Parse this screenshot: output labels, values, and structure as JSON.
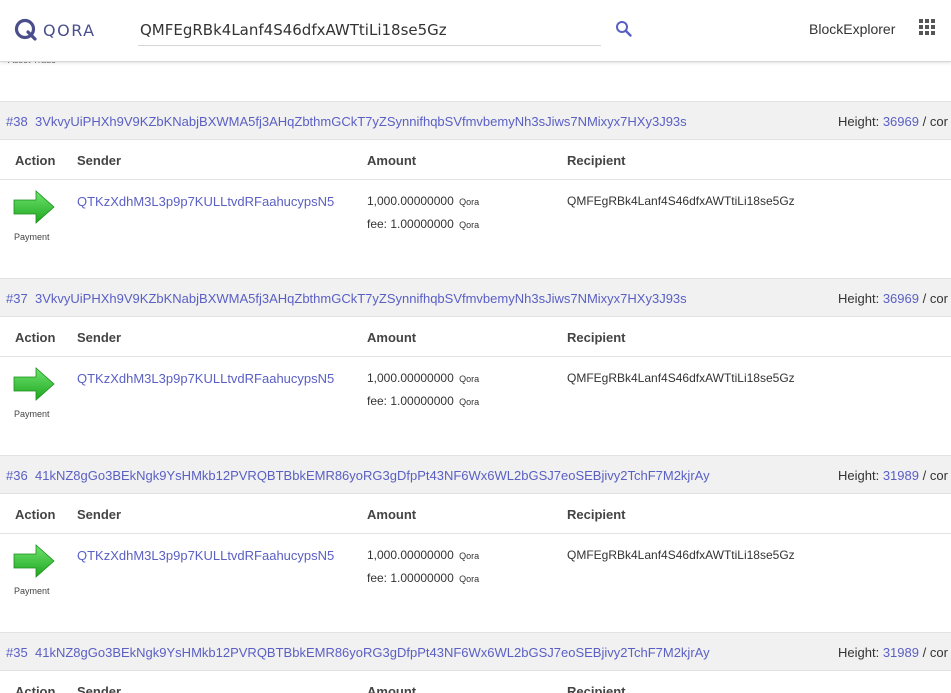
{
  "header": {
    "logo_text": "QORA",
    "search_value": "QMFEgRBk4Lanf4S46dfxAWTtiLi18se5Gz",
    "brand_link": "BlockExplorer",
    "accent_color": "#5a5fc4"
  },
  "partial_label": "Asset Trade",
  "columns": {
    "action": "Action",
    "sender": "Sender",
    "amount": "Amount",
    "recipient": "Recipient"
  },
  "labels": {
    "height": "Height:",
    "cut_text": "/ cor"
  },
  "transactions": [
    {
      "number": "#38",
      "signature": "3VkvyUiPHXh9V9KZbKNabjBXWMA5fj3AHqZbthmGCkT7yZSynnifhqbSVfmvbemyNh3sJiws7NMixyx7HXy3J93s",
      "height": "36969",
      "action_icon": "green-right-arrow",
      "action": "Payment",
      "sender": "QTKzXdhM3L3p9p7KULLtvdRFaahucypsN5",
      "amount": "1,000.00000000",
      "amount_unit": "Qora",
      "fee": "fee: 1.00000000",
      "fee_unit": "Qora",
      "recipient": "QMFEgRBk4Lanf4S46dfxAWTtiLi18se5Gz"
    },
    {
      "number": "#37",
      "signature": "3VkvyUiPHXh9V9KZbKNabjBXWMA5fj3AHqZbthmGCkT7yZSynnifhqbSVfmvbemyNh3sJiws7NMixyx7HXy3J93s",
      "height": "36969",
      "action_icon": "green-right-arrow",
      "action": "Payment",
      "sender": "QTKzXdhM3L3p9p7KULLtvdRFaahucypsN5",
      "amount": "1,000.00000000",
      "amount_unit": "Qora",
      "fee": "fee: 1.00000000",
      "fee_unit": "Qora",
      "recipient": "QMFEgRBk4Lanf4S46dfxAWTtiLi18se5Gz"
    },
    {
      "number": "#36",
      "signature": "41kNZ8gGo3BEkNgk9YsHMkb12PVRQBTBbkEMR86yoRG3gDfpPt43NF6Wx6WL2bGSJ7eoSEBjivy2TchF7M2kjrAy",
      "height": "31989",
      "action_icon": "green-right-arrow",
      "action": "Payment",
      "sender": "QTKzXdhM3L3p9p7KULLtvdRFaahucypsN5",
      "amount": "1,000.00000000",
      "amount_unit": "Qora",
      "fee": "fee: 1.00000000",
      "fee_unit": "Qora",
      "recipient": "QMFEgRBk4Lanf4S46dfxAWTtiLi18se5Gz"
    },
    {
      "number": "#35",
      "signature": "41kNZ8gGo3BEkNgk9YsHMkb12PVRQBTBbkEMR86yoRG3gDfpPt43NF6Wx6WL2bGSJ7eoSEBjivy2TchF7M2kjrAy",
      "height": "31989"
    }
  ]
}
